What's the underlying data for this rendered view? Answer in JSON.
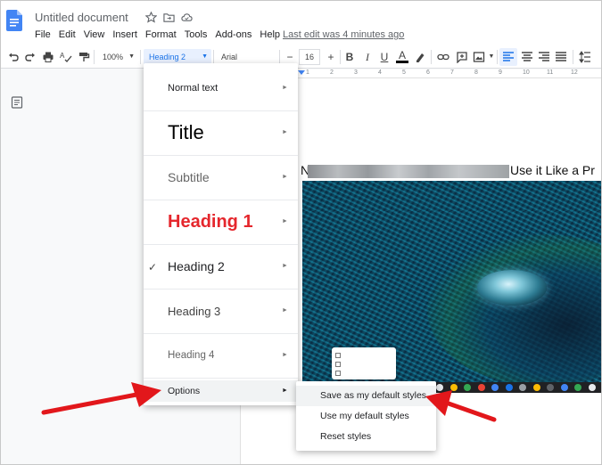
{
  "header": {
    "doc_title": "Untitled document",
    "menu": [
      "File",
      "Edit",
      "View",
      "Insert",
      "Format",
      "Tools",
      "Add-ons",
      "Help"
    ],
    "last_edit": "Last edit was 4 minutes ago"
  },
  "toolbar": {
    "zoom": "100%",
    "style": "Heading 2",
    "font": "Arial",
    "font_size": "16",
    "minus": "−",
    "plus": "+",
    "bold": "B",
    "italic": "I",
    "underline": "U",
    "text_color": "A"
  },
  "ruler": {
    "marks": [
      "1",
      "2",
      "3",
      "4",
      "5",
      "6",
      "7",
      "8",
      "9",
      "10",
      "11",
      "12"
    ]
  },
  "style_menu": {
    "items": [
      {
        "label": "Normal text",
        "selected": false
      },
      {
        "label": "Title",
        "selected": false
      },
      {
        "label": "Subtitle",
        "selected": false
      },
      {
        "label": "Heading 1",
        "selected": false
      },
      {
        "label": "Heading 2",
        "selected": true
      },
      {
        "label": "Heading 3",
        "selected": false
      },
      {
        "label": "Heading 4",
        "selected": false
      },
      {
        "label": "Options",
        "selected": false
      }
    ],
    "check": "✓",
    "arrow": "►"
  },
  "options_menu": {
    "items": [
      "Save as my default styles",
      "Use my default styles",
      "Reset styles"
    ]
  },
  "document": {
    "heading_start": "N",
    "heading_end": "Use it Like a Pr"
  },
  "colors": {
    "accent": "#1a73e8",
    "heading1": "#e5272d",
    "annotation_arrow": "#e2171b"
  }
}
